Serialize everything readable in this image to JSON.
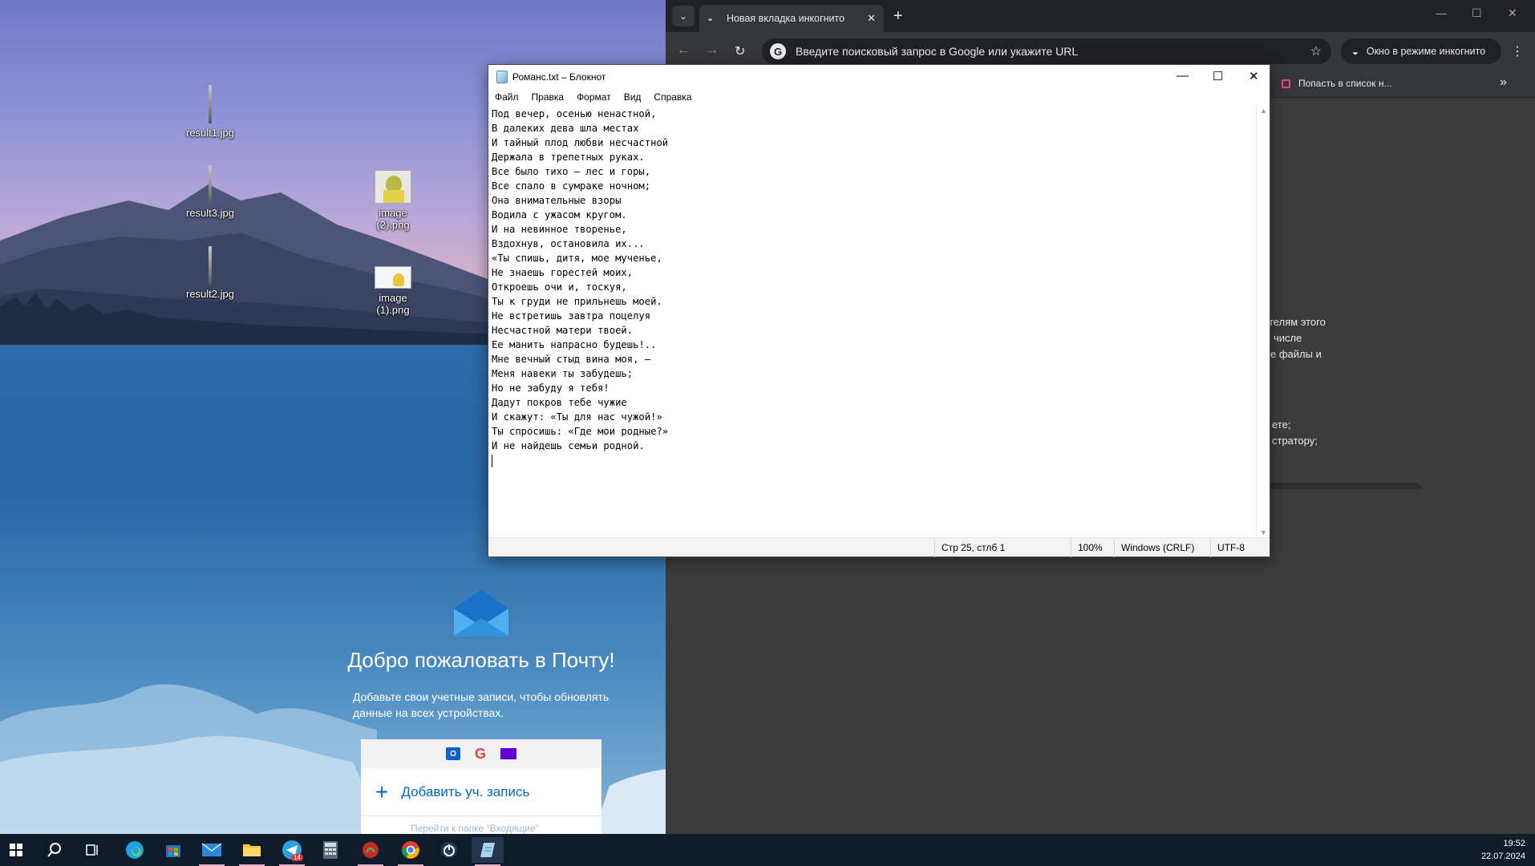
{
  "desktop": {
    "icons": [
      {
        "label": "result1.jpg"
      },
      {
        "label": "result3.jpg"
      },
      {
        "label": "result2.jpg"
      },
      {
        "label": "image (2).png"
      },
      {
        "label": "image (1).png"
      }
    ]
  },
  "mail": {
    "title": "Добро пожаловать в Почту!",
    "subtitle": "Добавьте свои учетные записи, чтобы обновлять данные на всех устройствах.",
    "add_account": "Добавить уч. запись",
    "inbox_link": "Перейти к папке \"Входящие\""
  },
  "chrome": {
    "tab_title": "Новая вкладка инкогнито",
    "omnibox_placeholder": "Введите поисковый запрос в Google или укажите URL",
    "incognito_label": "Окно в режиме инкогнито",
    "bookmark": "Попасть в список н...",
    "content_fragments": [
      "телям этого",
      "числе",
      "е файлы и",
      "ете;",
      "стратору;"
    ]
  },
  "notepad": {
    "title": "Романс.txt – Блокнот",
    "menu": [
      "Файл",
      "Правка",
      "Формат",
      "Вид",
      "Справка"
    ],
    "lines": [
      "Под вечер, осенью ненастной,",
      "В далеких дева шла местах",
      "И тайный плод любви несчастной",
      "Держала в трепетных руках.",
      "Все было тихо — лес и горы,",
      "Все спало в сумраке ночном;",
      "Она внимательные взоры",
      "Водила с ужасом кругом.",
      "И на невинное творенье,",
      "Вздохнув, остановила их...",
      "«Ты спишь, дитя, мое мученье,",
      "Не знаешь горестей моих,",
      "Откроешь очи и, тоскуя,",
      "Ты к груди не прильнешь моей.",
      "Не встретишь завтра поцелуя",
      "Несчастной матери твоей.",
      "Ее манить напрасно будешь!..",
      "Мне вечный стыд вина моя, —",
      "Меня навеки ты забудешь;",
      "Но не забуду я тебя!",
      "Дадут покров тебе чужие",
      "И скажут: «Ты для нас чужой!»",
      "Ты спросишь: «Где мои родные?»",
      "И не найдешь семьи родной."
    ],
    "status": {
      "position": "Стр 25, стлб 1",
      "zoom": "100%",
      "line_ending": "Windows (CRLF)",
      "encoding": "UTF-8"
    }
  },
  "taskbar": {
    "telegram_badge": "14",
    "time": "19:52",
    "date": "22.07.2024"
  }
}
